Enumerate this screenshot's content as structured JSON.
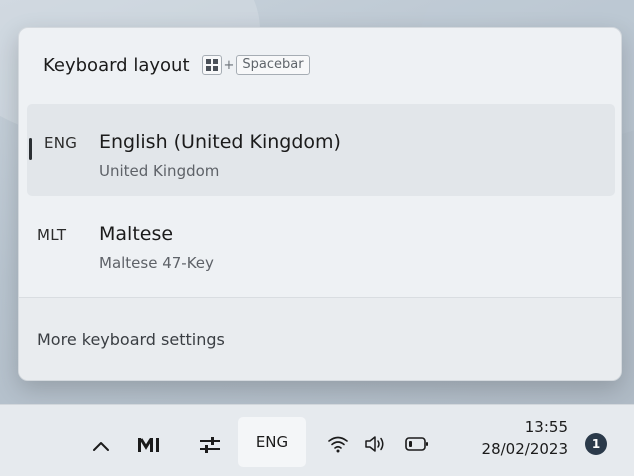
{
  "flyout": {
    "title": "Keyboard layout",
    "shortcut": {
      "plus": "+",
      "key": "Spacebar"
    },
    "layouts": [
      {
        "code": "ENG",
        "name": "English (United Kingdom)",
        "sub": "United Kingdom",
        "selected": true
      },
      {
        "code": "MLT",
        "name": "Maltese",
        "sub": "Maltese 47-Key",
        "selected": false
      }
    ],
    "more_settings": "More keyboard settings"
  },
  "taskbar": {
    "icons": [
      "chevron-up-icon",
      "mi-app-icon",
      "sliders-icon",
      "wifi-icon",
      "volume-icon",
      "battery-icon"
    ],
    "language": "ENG",
    "time": "13:55",
    "date": "28/02/2023",
    "notification_count": "1"
  },
  "colors": {
    "flyout_bg": "#eef1f4",
    "selected_bg": "#e2e6ea",
    "taskbar_bg": "#e6eaee",
    "badge_bg": "#2b3a4a"
  }
}
